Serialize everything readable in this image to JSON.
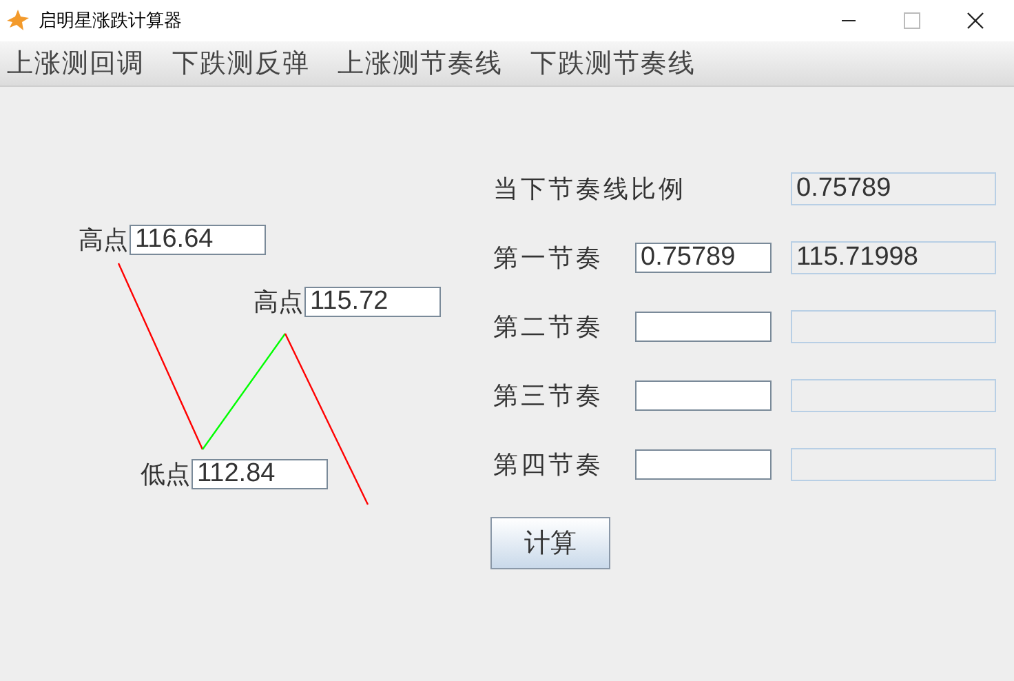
{
  "window": {
    "title": "启明星涨跌计算器"
  },
  "menu": [
    "上涨测回调",
    "下跌测反弹",
    "上涨测节奏线",
    "下跌测节奏线"
  ],
  "diagram": {
    "points": [
      {
        "label": "高点",
        "value": "116.64"
      },
      {
        "label": "高点",
        "value": "115.72"
      },
      {
        "label": "低点",
        "value": "112.84"
      }
    ],
    "segments": [
      {
        "color": "#ff0000"
      },
      {
        "color": "#00ff00"
      },
      {
        "color": "#ff0000"
      }
    ]
  },
  "ratio": {
    "label": "当下节奏线比例",
    "value": "0.75789"
  },
  "rhythms": [
    {
      "label": "第一节奏",
      "input": "0.75789",
      "output": "115.71998"
    },
    {
      "label": "第二节奏"
    },
    {
      "label": "第三节奏"
    },
    {
      "label": "第四节奏"
    }
  ],
  "button": "计算"
}
